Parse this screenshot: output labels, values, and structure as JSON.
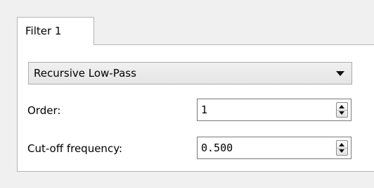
{
  "tabs": [
    {
      "label": "Filter 1",
      "active": true
    }
  ],
  "filter_type": {
    "selected": "Recursive Low-Pass"
  },
  "order": {
    "label": "Order:",
    "value": "1"
  },
  "cutoff": {
    "label": "Cut-off frequency:",
    "value": "0.500"
  },
  "colors": {
    "window_bg": "#f0f0f0",
    "panel_bg": "#ffffff",
    "border": "#b5b5b5"
  }
}
